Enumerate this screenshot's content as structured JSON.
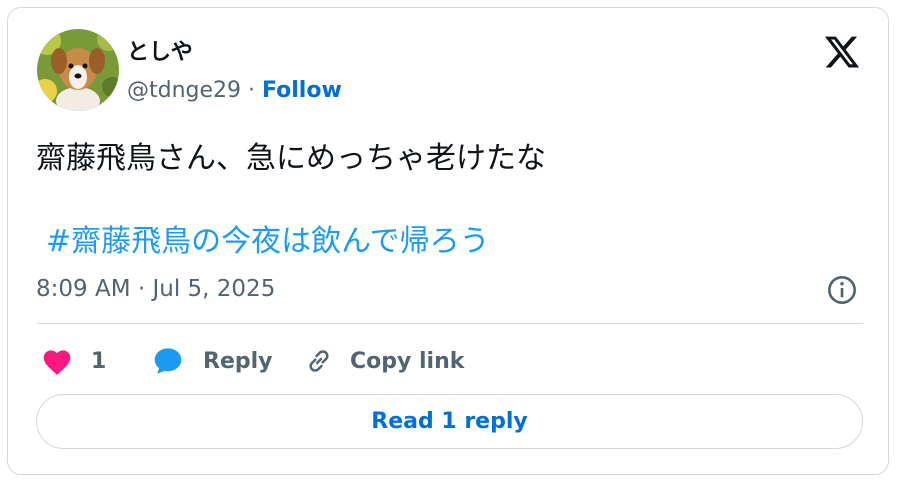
{
  "author": {
    "display_name": "としや",
    "handle": "@tdnge29",
    "separator": " · ",
    "follow_label": "Follow"
  },
  "tweet": {
    "text": "齋藤飛鳥さん、急にめっちゃ老けたな",
    "hashtag": "#齋藤飛鳥の今夜は飲んで帰ろう",
    "timestamp": "8:09 AM · Jul 5, 2025"
  },
  "actions": {
    "like_count": "1",
    "reply_label": "Reply",
    "copy_link_label": "Copy link"
  },
  "footer": {
    "read_replies_label": "Read 1 reply"
  },
  "colors": {
    "accent": "#006fd6",
    "hashtag": "#1d9bf0",
    "like": "#f91880",
    "reply_icon": "#1d9bf0",
    "secondary_text": "#536471",
    "border": "#cfd9de"
  },
  "icons": {
    "brand": "x-logo-icon",
    "info": "info-icon",
    "like": "heart-icon",
    "reply": "speech-bubble-icon",
    "copy_link": "link-icon"
  }
}
